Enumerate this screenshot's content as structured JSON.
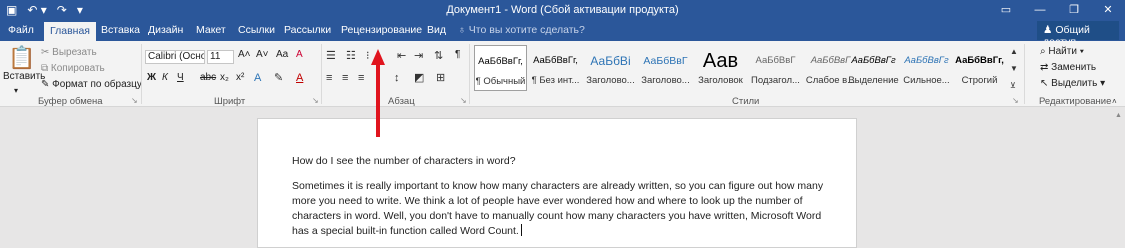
{
  "qat": {
    "save_icon": "save-icon",
    "undo_icon": "undo-icon",
    "redo_icon": "redo-icon",
    "custom_icon": "customize-icon"
  },
  "window": {
    "title": "Документ1 - Word (Сбой активации продукта)",
    "min": "—",
    "restore": "❐",
    "close": "✕",
    "ribbon_toggle": "▭"
  },
  "tabs": [
    {
      "label": "Файл"
    },
    {
      "label": "Главная"
    },
    {
      "label": "Вставка"
    },
    {
      "label": "Дизайн"
    },
    {
      "label": "Макет"
    },
    {
      "label": "Ссылки"
    },
    {
      "label": "Рассылки"
    },
    {
      "label": "Рецензирование"
    },
    {
      "label": "Вид"
    }
  ],
  "tellme": "Что вы хотите сделать?",
  "share": "Общий доступ",
  "clipboard": {
    "paste": "Вставить",
    "cut": "Вырезать",
    "copy": "Копировать",
    "format": "Формат по образцу",
    "group": "Буфер обмена"
  },
  "font": {
    "name": "Calibri (Осно",
    "size": "11",
    "group": "Шрифт",
    "bold": "Ж",
    "italic": "К",
    "underline": "Ч",
    "strike": "abc",
    "sub": "x₂",
    "sup": "x²",
    "grow": "A˄",
    "shrink": "A˅",
    "case": "Aa",
    "clear": "A"
  },
  "paragraph": {
    "group": "Абзац",
    "show": "¶"
  },
  "styles": {
    "group": "Стили",
    "items": [
      {
        "sample": "АаБбВвГг,",
        "name": "¶ Обычный"
      },
      {
        "sample": "АаБбВвГг,",
        "name": "¶ Без инт..."
      },
      {
        "sample": "АаБбВі",
        "name": "Заголово..."
      },
      {
        "sample": "АаБбВвГ",
        "name": "Заголово..."
      },
      {
        "sample": "Аав",
        "name": "Заголовок"
      },
      {
        "sample": "АаБбВвГ",
        "name": "Подзагол..."
      },
      {
        "sample": "АаБбВвГ",
        "name": "Слабое в..."
      },
      {
        "sample": "АаБбВвГг",
        "name": "Выделение"
      },
      {
        "sample": "АаБбВвГг",
        "name": "Сильное..."
      },
      {
        "sample": "АаБбВвГг,",
        "name": "Строгий"
      }
    ]
  },
  "editing": {
    "find": "Найти",
    "replace": "Заменить",
    "select": "Выделить",
    "group": "Редактирование"
  },
  "document": {
    "question": "How do I see the number of characters in word?",
    "paragraph": "Sometimes it is really important to know how many characters are already written, so you can figure out how many more you need to write. We think a lot of people have ever wondered how and where to look up the number of characters in word. Well, you don't have to manually count how many characters you have written, Microsoft Word has a special built-in function called Word Count."
  },
  "colors": {
    "accent": "#2b579a",
    "arrow": "#e0141e"
  }
}
